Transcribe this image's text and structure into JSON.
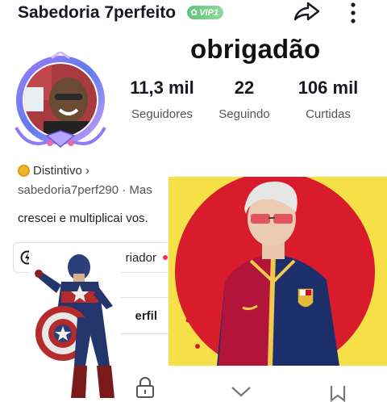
{
  "header": {
    "username": "Sabedoria 7perfeito",
    "vip_label": "VIP1"
  },
  "sticker_text": "obrigadão",
  "stats": [
    {
      "value": "11,3 mil",
      "label": "Seguidores"
    },
    {
      "value": "22",
      "label": "Seguindo"
    },
    {
      "value": "106 mil",
      "label": "Curtidas"
    }
  ],
  "profile": {
    "badge_label": "Distintivo",
    "badge_chevron": "›",
    "handle": "sabedoria7perf290 · Mas",
    "bio": "crescei e multiplicai vos.",
    "creator_button": "riador",
    "edit_button": "erfil"
  },
  "icons": [
    "share-icon",
    "more-icon",
    "lock-icon",
    "heart-icon",
    "bookmark-icon",
    "badge-icon",
    "creator-icon"
  ],
  "colors": {
    "vip_green": "#5ec47a",
    "accent_red": "#fe2c55",
    "badge_gold": "#f0b429",
    "overlay_yellow": "#f5e047",
    "overlay_red": "#d81c2c"
  }
}
